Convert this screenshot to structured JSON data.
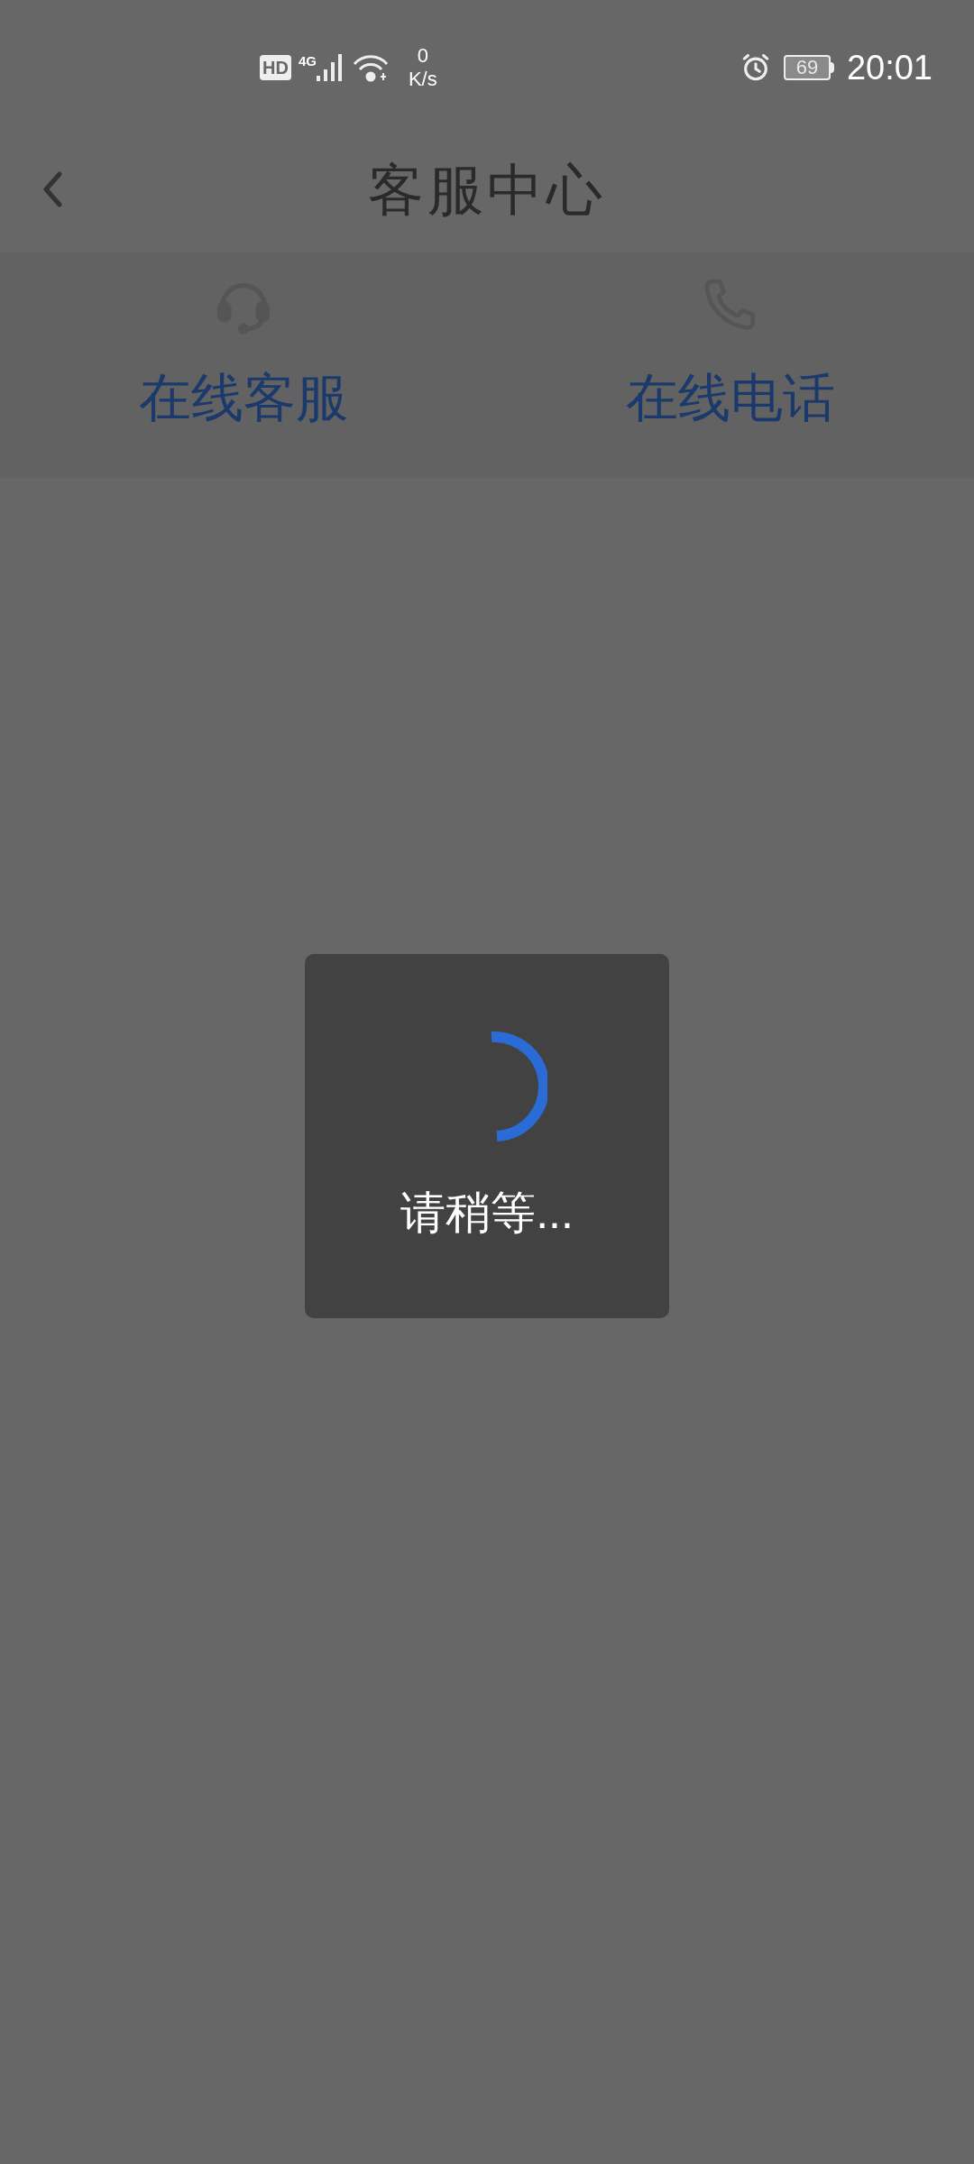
{
  "status_bar": {
    "hd_badge": "HD",
    "network": "4G",
    "speed_value": "0",
    "speed_unit": "K/s",
    "battery": "69",
    "time": "20:01"
  },
  "header": {
    "title": "客服中心"
  },
  "tabs": [
    {
      "label": "在线客服",
      "kind": "headset"
    },
    {
      "label": "在线电话",
      "kind": "phone"
    }
  ],
  "loading_dialog": {
    "message": "请稍等..."
  }
}
